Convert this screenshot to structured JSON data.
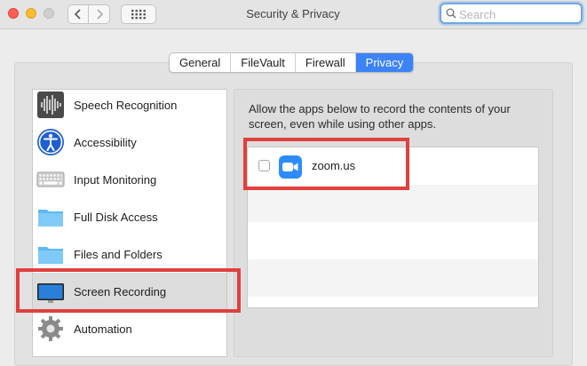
{
  "window": {
    "title": "Security & Privacy"
  },
  "search": {
    "placeholder": "Search"
  },
  "tabs": [
    {
      "label": "General",
      "active": false
    },
    {
      "label": "FileVault",
      "active": false
    },
    {
      "label": "Firewall",
      "active": false
    },
    {
      "label": "Privacy",
      "active": true
    }
  ],
  "sidebar": {
    "items": [
      {
        "label": "Speech Recognition",
        "icon": "speech-waveform-icon"
      },
      {
        "label": "Accessibility",
        "icon": "accessibility-icon"
      },
      {
        "label": "Input Monitoring",
        "icon": "keyboard-icon"
      },
      {
        "label": "Full Disk Access",
        "icon": "folder-icon"
      },
      {
        "label": "Files and Folders",
        "icon": "folder-icon"
      },
      {
        "label": "Screen Recording",
        "icon": "display-icon",
        "selected": true
      },
      {
        "label": "Automation",
        "icon": "gear-icon"
      }
    ]
  },
  "main": {
    "description": "Allow the apps below to record the contents of your screen, even while using other apps.",
    "apps": [
      {
        "name": "zoom.us",
        "checked": false,
        "icon": "zoom-camera-icon"
      }
    ]
  },
  "colors": {
    "accent": "#3b83f6",
    "highlight": "#e0403e",
    "zoom": "#2d8cff"
  }
}
